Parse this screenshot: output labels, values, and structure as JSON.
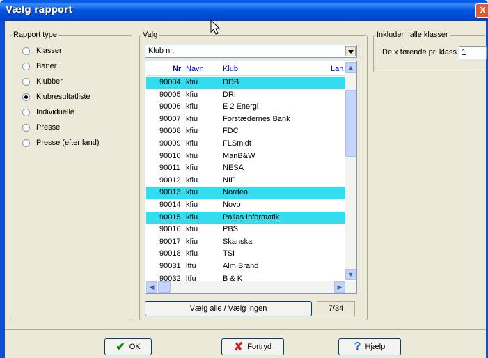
{
  "window": {
    "title": "Vælg rapport",
    "close_label": "X"
  },
  "rapport_type": {
    "legend": "Rapport type",
    "options": [
      {
        "label": "Klasser",
        "checked": false
      },
      {
        "label": "Baner",
        "checked": false
      },
      {
        "label": "Klubber",
        "checked": false
      },
      {
        "label": "Klubresultatliste",
        "checked": true
      },
      {
        "label": "Individuelle",
        "checked": false
      },
      {
        "label": "Presse",
        "checked": false
      },
      {
        "label": "Presse (efter land)",
        "checked": false
      }
    ]
  },
  "valg": {
    "legend": "Valg",
    "dropdown_value": "Klub nr.",
    "columns": {
      "nr": "Nr",
      "navn": "Navn",
      "klub": "Klub",
      "land": "Lan"
    },
    "rows": [
      {
        "nr": "90004",
        "navn": "kfiu",
        "klub": "DDB",
        "selected": true
      },
      {
        "nr": "90005",
        "navn": "kfiu",
        "klub": "DRI",
        "selected": false
      },
      {
        "nr": "90006",
        "navn": "kfiu",
        "klub": "E 2 Energi",
        "selected": false
      },
      {
        "nr": "90007",
        "navn": "kfiu",
        "klub": "Forstædernes Bank",
        "selected": false
      },
      {
        "nr": "90008",
        "navn": "kfiu",
        "klub": "FDC",
        "selected": false
      },
      {
        "nr": "90009",
        "navn": "kfiu",
        "klub": "FLSmidt",
        "selected": false
      },
      {
        "nr": "90010",
        "navn": "kfiu",
        "klub": "ManB&W",
        "selected": false
      },
      {
        "nr": "90011",
        "navn": "kfiu",
        "klub": "NESA",
        "selected": false
      },
      {
        "nr": "90012",
        "navn": "kfiu",
        "klub": "NIF",
        "selected": false
      },
      {
        "nr": "90013",
        "navn": "kfiu",
        "klub": "Nordea",
        "selected": true
      },
      {
        "nr": "90014",
        "navn": "kfiu",
        "klub": "Novo",
        "selected": false
      },
      {
        "nr": "90015",
        "navn": "kfiu",
        "klub": "Pallas Informatik",
        "selected": true
      },
      {
        "nr": "90016",
        "navn": "kfiu",
        "klub": "PBS",
        "selected": false
      },
      {
        "nr": "90017",
        "navn": "kfiu",
        "klub": "Skanska",
        "selected": false
      },
      {
        "nr": "90018",
        "navn": "kfiu",
        "klub": "TSI",
        "selected": false
      },
      {
        "nr": "90031",
        "navn": "ltfu",
        "klub": "Alm.Brand",
        "selected": false
      },
      {
        "nr": "90032",
        "navn": "ltfu",
        "klub": "B & K",
        "selected": false
      }
    ],
    "select_all_label": "Vælg alle / Vælg ingen",
    "count": "7/34"
  },
  "inkluder": {
    "legend": "Inkluder i alle klasser",
    "field_label": "De x førende pr. klass",
    "field_value": "1"
  },
  "buttons": {
    "ok": "OK",
    "fortryd": "Fortryd",
    "hjaelp": "Hjælp"
  },
  "colors": {
    "selection": "#33ddee",
    "title_bar": "#0054e3",
    "header_text": "#0000d0"
  }
}
